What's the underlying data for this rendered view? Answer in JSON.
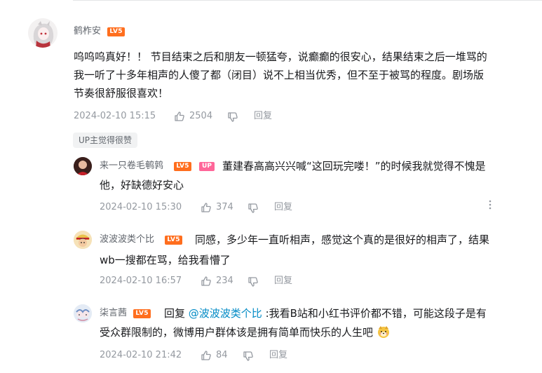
{
  "comments": [
    {
      "user": "鹤柞安",
      "level": "LV5",
      "lines": [
        "呜呜呜真好！！ 节目结束之后和朋友一顿猛夸，说癫癫的很安心，结果结束之后一堆骂的",
        "我一听了十多年相声的人傻了都（闭目）说不上相当优秀，但不至于被骂的程度。剧场版",
        "节奏很舒服很喜欢！"
      ],
      "time": "2024-02-10 15:15",
      "likes": "2504",
      "reply_label": "回复",
      "tag": "UP主觉得很赞"
    }
  ],
  "replies": [
    {
      "user": "来一只卷毛鹌鹑",
      "level": "LV5",
      "badge": "UP",
      "lines": [
        "董建春高高兴兴喊“这回玩完喽！”的时候我就觉得不愧是",
        "他，好缺德好安心"
      ],
      "time": "2024-02-10 15:30",
      "likes": "374",
      "reply_label": "回复"
    },
    {
      "user": "波波波类个比",
      "level": "LV5",
      "lines": [
        "同感，多少年一直听相声，感觉这个真的是很好的相声了，结果",
        "wb一搜都在骂，给我看懵了"
      ],
      "time": "2024-02-10 16:57",
      "likes": "234",
      "reply_label": "回复"
    },
    {
      "user": "柒言茜",
      "level": "LV5",
      "reply_prefix": "回复 ",
      "reply_at": "@波波波类个比",
      "line1_rest": " :我看B站和小红书评价都不错，可能这段子是有",
      "line2": "受众群限制的，微博用户群体该是拥有简单而快乐的人生吧",
      "time": "2024-02-10 21:42",
      "likes": "84",
      "reply_label": "回复"
    }
  ],
  "icons": [
    "thumb-up-icon",
    "thumb-down-icon",
    "more-vertical-icon",
    "doge-emoji-icon"
  ],
  "colors": {
    "level_badge": "#ff6e1e",
    "up_badge": "#ff6699",
    "link": "#008ac5",
    "meta": "#9499a0"
  }
}
